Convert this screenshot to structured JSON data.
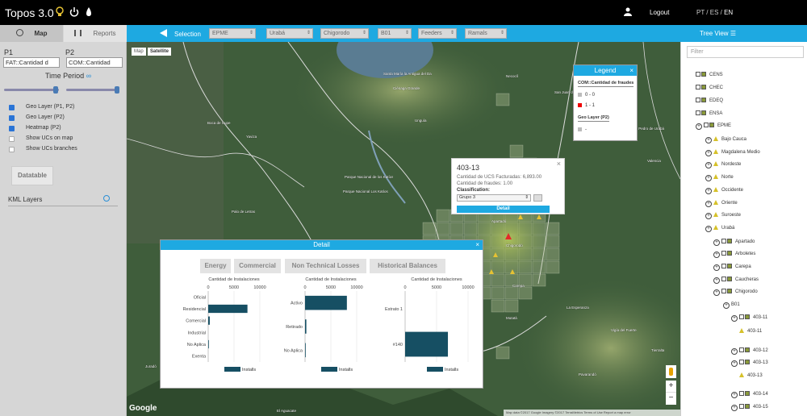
{
  "header": {
    "title": "Topos 3.0",
    "logout": "Logout",
    "lang_pt": "PT",
    "lang_es": "ES",
    "lang_en": "EN"
  },
  "sidebar": {
    "tab_map": "Map",
    "tab_reports": "Reports",
    "p1_label": "P1",
    "p2_label": "P2",
    "p1_value": "FAT::Cantidad d",
    "p2_value": "COM::Cantidad",
    "time_period": "Time Period",
    "checks": [
      {
        "label": "Geo Layer (P1, P2)",
        "checked": true
      },
      {
        "label": "Geo Layer (P2)",
        "checked": true
      },
      {
        "label": "Heatmap (P2)",
        "checked": true
      },
      {
        "label": "Show UCs on map",
        "checked": false
      },
      {
        "label": "Show UCs branches",
        "checked": false
      }
    ],
    "datatable": "Datatable",
    "kml": "KML Layers"
  },
  "selbar": {
    "selection": "Selection",
    "dropdowns": [
      "EPME",
      "Urabá",
      "Chigorodo",
      "B01",
      "Feeders",
      "Ramals"
    ],
    "tree_view": "Tree View"
  },
  "map": {
    "btn_map": "Map",
    "btn_satellite": "Satellite",
    "google": "Google",
    "attribution": "Map data ©2017 Google Imagery ©2017 TerraMetrics  Terms of Use  Report a map error",
    "labels": [
      "Santa María la Antigua del Darién",
      "Ciénaga Grande",
      "Unguía",
      "Boca de Cupe",
      "Yaviza",
      "Parque Nacional de los Katíos",
      "Parque Nacional Los Katíos",
      "Palo de Letras",
      "Turbo",
      "Necoclí",
      "San Juan de Urabá",
      "Arboletes",
      "Chigorodó",
      "Carepa",
      "Apartadó",
      "Mutatá",
      "Rio Sucio",
      "Juradó",
      "Vigía del Fuerte",
      "Pavarandó",
      "Tierralta",
      "La Esperanza",
      "El Aguacate",
      "Valencia",
      "San Pedro de Urabá"
    ]
  },
  "legend": {
    "title": "Legend",
    "close": "×",
    "sec1": "COM::Cantidad de fraudes",
    "item1": "0 - 0",
    "item2": "1 - 1",
    "sec2": "Geo Layer (P2)",
    "item3": "-"
  },
  "popup": {
    "title": "403-13",
    "line1": "Cantidad de UCS Facturadas: 6,893.00",
    "line2": "Cantidad de fraudes: 1.00",
    "class_label": "Classification:",
    "class_value": "Grupo 3",
    "detail": "Detail",
    "close": "×"
  },
  "detail": {
    "title": "Detail",
    "close": "×",
    "tabs": [
      "Energy",
      "Commercial",
      "Non Technical Losses",
      "Historical Balances"
    ],
    "legend_label": "Installs"
  },
  "chart_data": [
    {
      "type": "bar",
      "orientation": "horizontal",
      "title": "Cantidad de Instalaciones",
      "categories": [
        "Oficial",
        "Residencial",
        "Comercial",
        "Industrial",
        "No Aplica",
        "Exenta"
      ],
      "series": [
        {
          "name": "Installs",
          "values": [
            0,
            7600,
            300,
            0,
            60,
            0
          ]
        }
      ],
      "xlim": [
        0,
        10000
      ],
      "xticks": [
        0,
        5000,
        10000
      ]
    },
    {
      "type": "bar",
      "orientation": "horizontal",
      "title": "Cantidad de Instalaciones",
      "categories": [
        "Activo",
        "Retirado",
        "No Aplica"
      ],
      "series": [
        {
          "name": "Installs",
          "values": [
            8100,
            250,
            30
          ]
        }
      ],
      "xlim": [
        0,
        10000
      ],
      "xticks": [
        0,
        5000,
        10000
      ]
    },
    {
      "type": "bar",
      "orientation": "horizontal",
      "title": "Cantidad de Instalaciones",
      "categories": [
        "Estrato 1",
        "#140"
      ],
      "series": [
        {
          "name": "Installs",
          "values": [
            0,
            6800
          ]
        }
      ],
      "xlim": [
        0,
        10000
      ],
      "xticks": [
        0,
        5000,
        10000
      ]
    }
  ],
  "tree": {
    "filter_placeholder": "Filter",
    "nodes": [
      "CENS",
      "CHEC",
      "EDEQ",
      "ENSA",
      "EPME",
      "Bajo Cauca",
      "Magdalena Medio",
      "Nordeste",
      "Norte",
      "Occidente",
      "Oriente",
      "Suroeste",
      "Urabá",
      "Apartado",
      "Arboletes",
      "Carepa",
      "Caucheras",
      "Chigorodo",
      "B01",
      "403-11",
      "403-11",
      "403-12",
      "403-13",
      "403-13",
      "403-14",
      "403-15"
    ]
  },
  "colors": {
    "accent": "#1ea9e1",
    "bar": "#164f63"
  }
}
